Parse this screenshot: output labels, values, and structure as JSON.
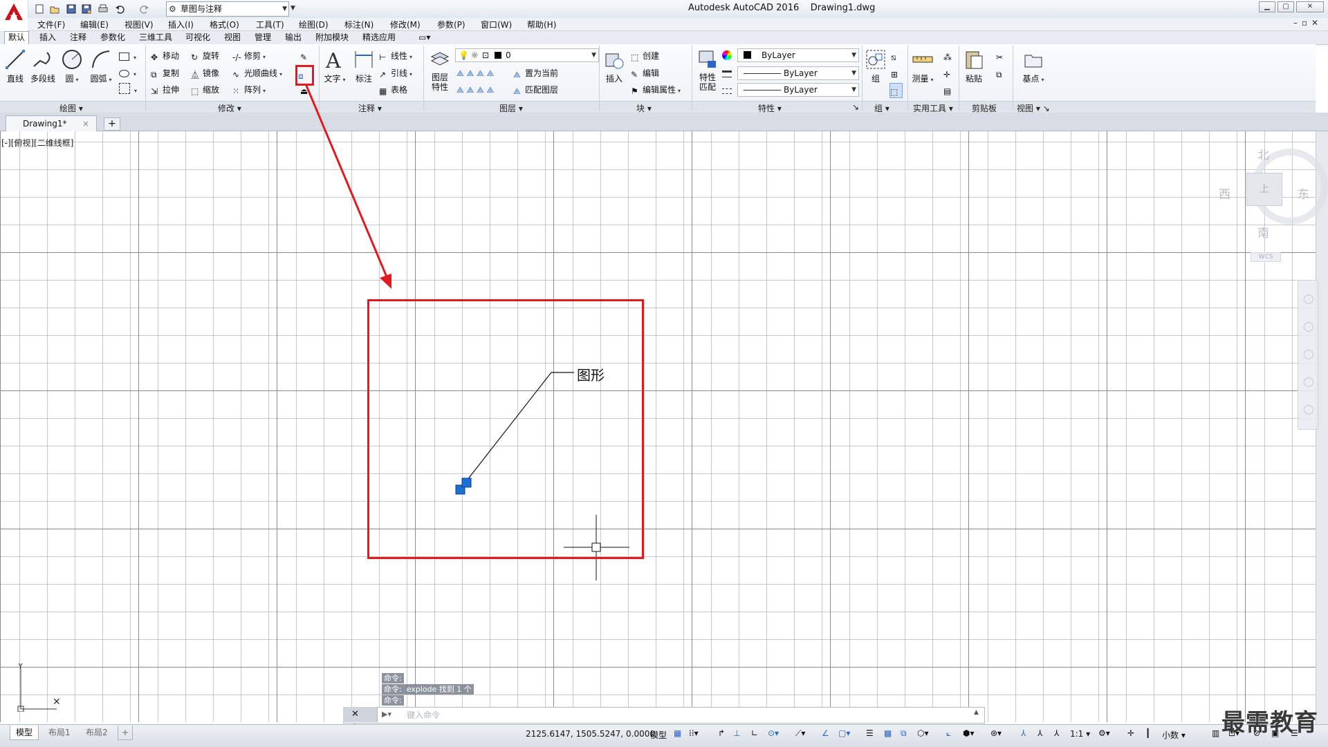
{
  "app": {
    "title": "Autodesk AutoCAD 2016    Drawing1.dwg",
    "workspace": "草图与注释"
  },
  "menus": [
    "文件(F)",
    "编辑(E)",
    "视图(V)",
    "插入(I)",
    "格式(O)",
    "工具(T)",
    "绘图(D)",
    "标注(N)",
    "修改(M)",
    "参数(P)",
    "窗口(W)",
    "帮助(H)"
  ],
  "ribbon_tabs": [
    "默认",
    "插入",
    "注释",
    "参数化",
    "三维工具",
    "可视化",
    "视图",
    "管理",
    "输出",
    "附加模块",
    "精选应用"
  ],
  "ribbon": {
    "draw": {
      "title": "绘图",
      "line": "直线",
      "polyline": "多段线",
      "circle": "圆",
      "arc": "圆弧"
    },
    "modify": {
      "title": "修改",
      "move": "移动",
      "rotate": "旋转",
      "trim": "修剪",
      "copy": "复制",
      "mirror": "镜像",
      "spline": "光顺曲线",
      "stretch": "拉伸",
      "scale": "缩放",
      "array": "阵列"
    },
    "annotation": {
      "title": "注释",
      "text": "文字",
      "dim": "标注",
      "linetype": "线性",
      "leader": "引线",
      "table": "表格"
    },
    "layers": {
      "title": "图层",
      "props": "图层\n特性",
      "layer_name": "0",
      "set_current": "置为当前",
      "match_layer": "匹配图层"
    },
    "block": {
      "title": "块",
      "insert": "插入",
      "create": "创建",
      "edit": "编辑",
      "edit_attr": "编辑属性"
    },
    "properties": {
      "title": "特性",
      "match": "特性\n匹配",
      "color": "ByLayer",
      "linetype": "ByLayer",
      "lineweight": "ByLayer"
    },
    "groups": {
      "title": "组",
      "group": "组"
    },
    "utilities": {
      "title": "实用工具",
      "measure": "测量"
    },
    "clipboard": {
      "title": "剪贴板",
      "paste": "粘贴"
    },
    "view": {
      "title": "视图",
      "base": "基点"
    }
  },
  "doc_tab": {
    "name": "Drawing1*"
  },
  "viewport": {
    "label": "[-][俯视][二维线框]",
    "viewcube": {
      "north": "北",
      "south": "南",
      "east": "东",
      "west": "西",
      "top": "上",
      "wcs": "WCS"
    },
    "leader_text": "图形"
  },
  "command": {
    "history": [
      "命令:",
      "命令:  explode 找到 1 个",
      "命令:"
    ],
    "placeholder": "键入命令"
  },
  "layout_tabs": [
    "模型",
    "布局1",
    "布局2"
  ],
  "status": {
    "coords": "2125.6147, 1505.5247, 0.0000",
    "model": "模型",
    "scale": "1:1",
    "units": "小数"
  },
  "watermark": "最需教育",
  "colors": {
    "accent_red": "#e3191f",
    "grip_blue": "#1c6fd6",
    "ribbon_bg": "#eef1f5"
  }
}
